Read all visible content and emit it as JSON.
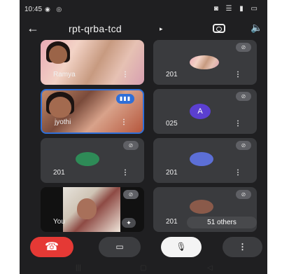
{
  "status_bar": {
    "time": "10:45",
    "left_icons": "◉ ◎",
    "right_icons": "◙ ☰ ▮ ▭"
  },
  "header": {
    "back_icon": "←",
    "meeting_code": "rpt-qrba-tcd",
    "caret": "▸",
    "speaker_icon": "🔈"
  },
  "tiles": [
    {
      "name": "Ramya",
      "more": "⋮"
    },
    {
      "name": "201",
      "more": "⋮",
      "muted": true
    },
    {
      "name": "jyothi",
      "more": "⋮",
      "speaking": true
    },
    {
      "name": "025",
      "more": "⋮",
      "muted": true,
      "avatar_letter": "A",
      "avatar_color": "#5b3fd0"
    },
    {
      "name": "201",
      "more": "⋮",
      "muted": true,
      "avatar_color": "#2e8b57"
    },
    {
      "name": "201",
      "more": "⋮",
      "muted": true,
      "avatar_color": "#5c6fd6"
    },
    {
      "name": "You",
      "muted": true,
      "effects_icon": "✦"
    },
    {
      "name": "201",
      "muted": true,
      "others_label": "51 others",
      "avatar_color": "#8a5a4a"
    }
  ],
  "controls": {
    "end_call_icon": "☎",
    "camera_icon": "▭",
    "mic_icon": "🎙",
    "more_icon": "⋮"
  },
  "nav": {
    "recents": "|||",
    "home": "▢",
    "back": "◁"
  },
  "colors": {
    "end_call": "#e53935",
    "speaking_badge": "#2f6fd8",
    "background": "#1f1f21"
  }
}
